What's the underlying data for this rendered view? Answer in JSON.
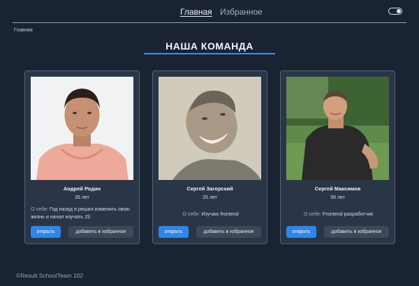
{
  "nav": {
    "home": "Главная",
    "favorites": "Избранное"
  },
  "theme_toggle": {
    "state": "on"
  },
  "breadcrumb": "Главная",
  "page_title": "НАША КОМАНДА",
  "members": [
    {
      "name": "Андрей Родин",
      "age": "35 лет",
      "about_label": "О себе:",
      "about": "Год назад я решил изменить свою жизнь и начал изучать JS",
      "open_label": "открыть",
      "fav_label": "добавить в избранное"
    },
    {
      "name": "Сергей Загорский",
      "age": "25 лет",
      "about_label": "О себе:",
      "about": "Изучаю frontend",
      "open_label": "открыть",
      "fav_label": "добавить в избранное"
    },
    {
      "name": "Сергей Максимов",
      "age": "39 лет",
      "about_label": "О себе:",
      "about": "Frontend разработчик",
      "open_label": "открыть",
      "fav_label": "добавить в избранное"
    }
  ],
  "footer": "©Result SchoolTeam 102",
  "colors": {
    "background": "#1a2332",
    "card": "#2a3648",
    "accent": "#2f86e6",
    "secondary_button": "#3d4858"
  }
}
